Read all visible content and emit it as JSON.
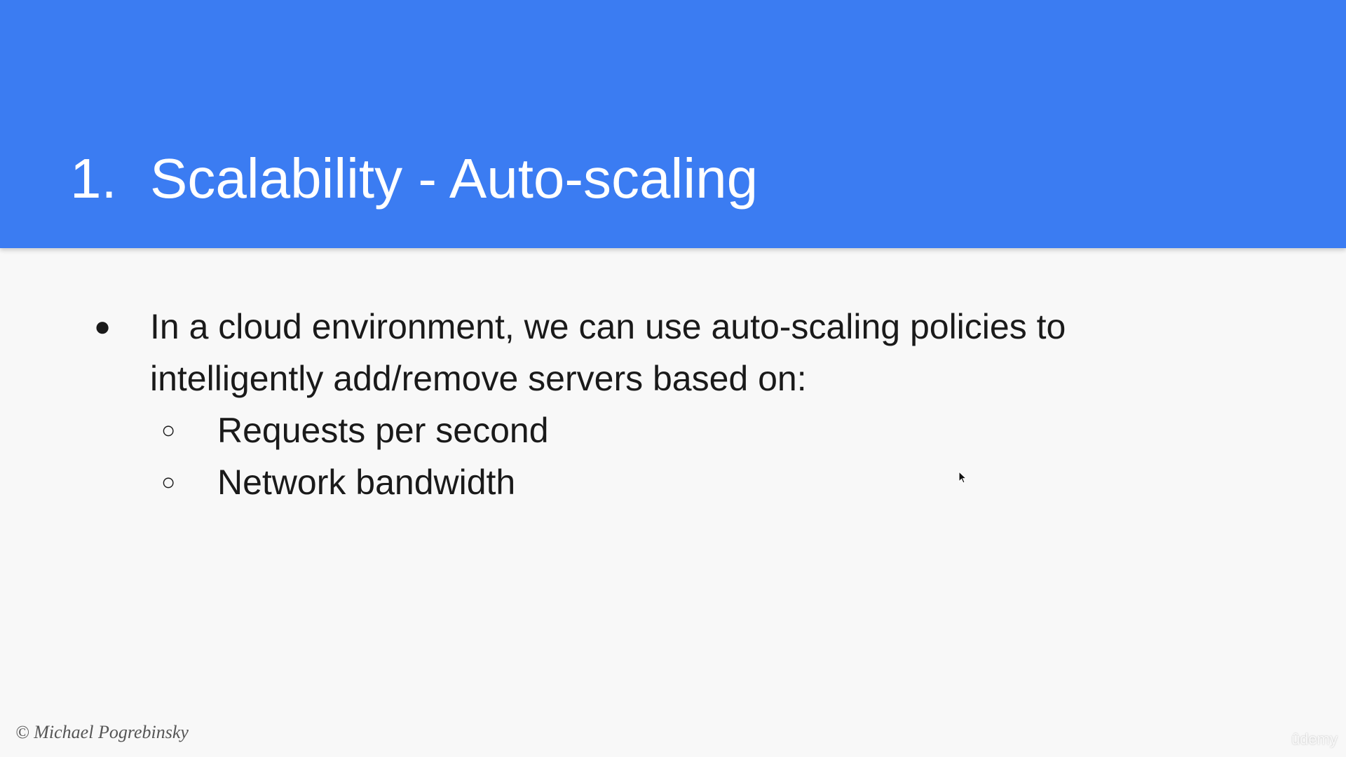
{
  "slide": {
    "title_number": "1.",
    "title_text": "Scalability - Auto-scaling",
    "bullet": {
      "marker": "●",
      "text": "In a cloud environment, we can use auto-scaling policies to intelligently add/remove servers based on:"
    },
    "sub_bullets": [
      {
        "marker": "○",
        "text": "Requests per second"
      },
      {
        "marker": "○",
        "text": "Network bandwidth"
      }
    ],
    "credit": "© Michael Pogrebinsky",
    "watermark": "ûdemy"
  },
  "colors": {
    "header_background": "#3b7cf2",
    "slide_background": "#f8f8f8",
    "title_text": "#ffffff",
    "body_text": "#1a1a1a"
  },
  "icons": {
    "cursor": "mouse-pointer-icon"
  }
}
